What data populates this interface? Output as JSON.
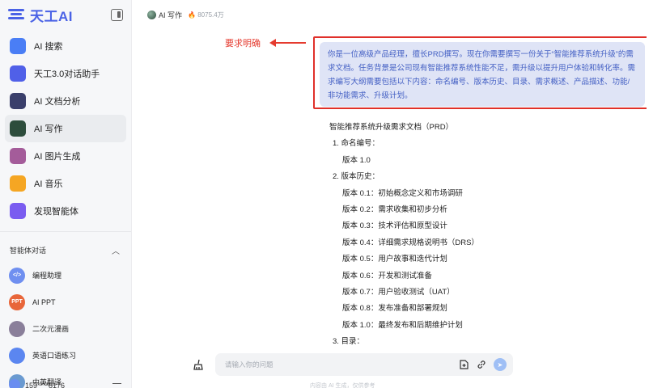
{
  "brand": {
    "name": "天工AI",
    "accent": "#4a62e6"
  },
  "sidebar": {
    "nav": [
      {
        "label": "AI 搜索",
        "icon": "search-icon",
        "color": "#4a7ef5"
      },
      {
        "label": "天工3.0对话助手",
        "icon": "chat-logo-icon",
        "color": "#5060e8"
      },
      {
        "label": "AI 文档分析",
        "icon": "document-icon",
        "color": "#3a3f6b"
      },
      {
        "label": "AI 写作",
        "icon": "writing-icon",
        "color": "#2d4d3c"
      },
      {
        "label": "AI 图片生成",
        "icon": "image-icon",
        "color": "#a45c9a"
      },
      {
        "label": "AI 音乐",
        "icon": "music-icon",
        "color": "#f5a623"
      },
      {
        "label": "发现智能体",
        "icon": "agent-icon",
        "color": "#7a5cf0"
      }
    ],
    "section_title": "智能体对话",
    "agents": [
      {
        "label": "编程助理",
        "icon": "code-icon",
        "color": "#6f8ff0",
        "glyph": "</>"
      },
      {
        "label": "AI PPT",
        "icon": "ppt-icon",
        "color": "#e8663a",
        "glyph": "PPT"
      },
      {
        "label": "二次元漫画",
        "icon": "anime-icon",
        "color": "#8a7f9a",
        "glyph": ""
      },
      {
        "label": "英语口语练习",
        "icon": "speech-icon",
        "color": "#5b86f0",
        "glyph": ""
      },
      {
        "label": "中英翻译",
        "icon": "translate-icon",
        "color": "#6a9ad0",
        "glyph": ""
      }
    ],
    "user_label": "159****8176"
  },
  "topbar": {
    "title": "AI 写作",
    "badge": "8075.4万"
  },
  "annotation": {
    "label": "要求明确",
    "color": "#e53b2f"
  },
  "prompt": {
    "text": "你是一位高级产品经理，擅长PRD撰写。现在你需要撰写一份关于“智能推荐系统升级”的需求文档。任务背景是公司现有智能推荐系统性能不足，需升级以提升用户体验和转化率。需求编写大纲需要包括以下内容：命名编号、版本历史、目录、需求概述、产品描述、功能/非功能需求、升级计划。"
  },
  "doc": {
    "lines": [
      {
        "text": "智能推荐系统升级需求文档（PRD）",
        "level": 0
      },
      {
        "text": "1. 命名编号：",
        "level": 1
      },
      {
        "text": "版本 1.0",
        "level": 2
      },
      {
        "text": "2. 版本历史：",
        "level": 1
      },
      {
        "text": "版本 0.1：初始概念定义和市场调研",
        "level": 2
      },
      {
        "text": "版本 0.2：需求收集和初步分析",
        "level": 2
      },
      {
        "text": "版本 0.3：技术评估和原型设计",
        "level": 2
      },
      {
        "text": "版本 0.4：详细需求规格说明书（DRS）",
        "level": 2
      },
      {
        "text": "版本 0.5：用户故事和迭代计划",
        "level": 2
      },
      {
        "text": "版本 0.6：开发和测试准备",
        "level": 2
      },
      {
        "text": "版本 0.7：用户验收测试（UAT）",
        "level": 2
      },
      {
        "text": "版本 0.8：发布准备和部署规划",
        "level": 2
      },
      {
        "text": "版本 1.0：最终发布和后期维护计划",
        "level": 2
      },
      {
        "text": "3. 目录：",
        "level": 1
      }
    ]
  },
  "input": {
    "placeholder": "请输入你的问题"
  },
  "footer": {
    "note": "内容由 AI 生成，仅供参考"
  }
}
